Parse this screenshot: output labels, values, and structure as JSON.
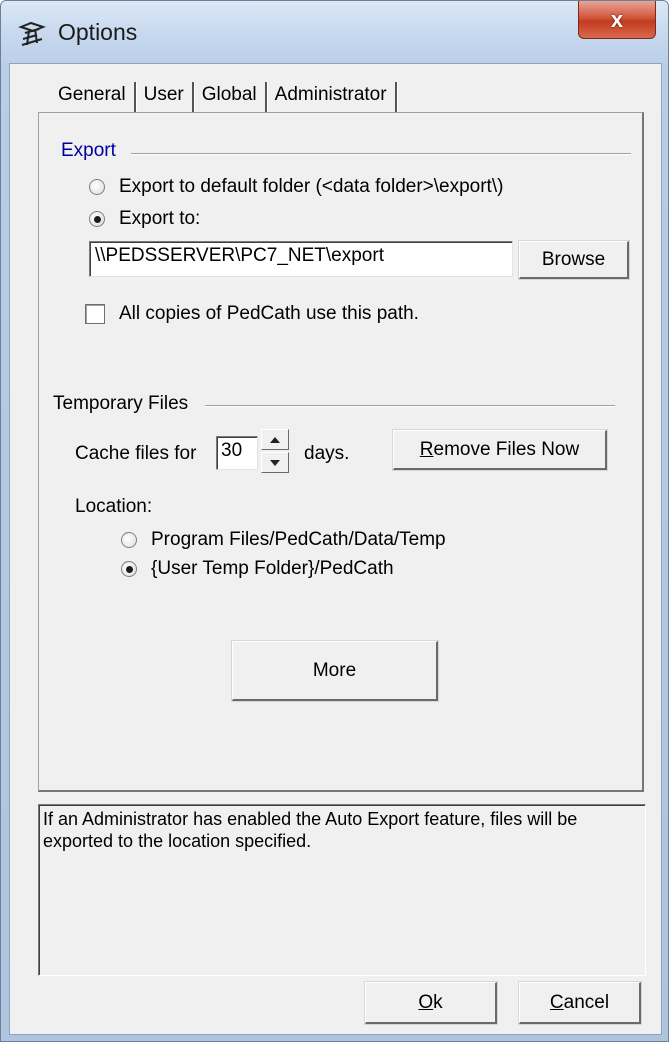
{
  "window": {
    "title": "Options",
    "close_label": "x"
  },
  "tabs": [
    {
      "label": "General"
    },
    {
      "label": "User"
    },
    {
      "label": "Global"
    },
    {
      "label": "Administrator"
    }
  ],
  "export": {
    "group_label": "Export",
    "group_label_color": "#0000a0",
    "option_default": "Export to default folder (<data folder>\\export\\)",
    "option_custom": "Export to:",
    "path_value": "\\\\PEDSSERVER\\PC7_NET\\export",
    "browse_label": "Browse",
    "all_copies_label": "All copies of PedCath use this path.",
    "all_copies_checked": false,
    "selected_option": "custom"
  },
  "temp_files": {
    "group_label": "Temporary Files",
    "cache_prefix": "Cache files for",
    "cache_days": "30",
    "cache_suffix": "days.",
    "remove_button": {
      "accel": "R",
      "rest": "emove Files Now"
    },
    "location_label": "Location:",
    "location_option_1": "Program Files/PedCath/Data/Temp",
    "location_option_2": "{User Temp Folder}/PedCath",
    "selected_location": 2
  },
  "more_button": "More",
  "info_text": "If an Administrator has enabled the Auto Export feature, files will be exported to the location specified.",
  "footer": {
    "ok": {
      "accel": "O",
      "rest": "k"
    },
    "cancel": {
      "accel": "C",
      "rest": "ancel"
    }
  }
}
